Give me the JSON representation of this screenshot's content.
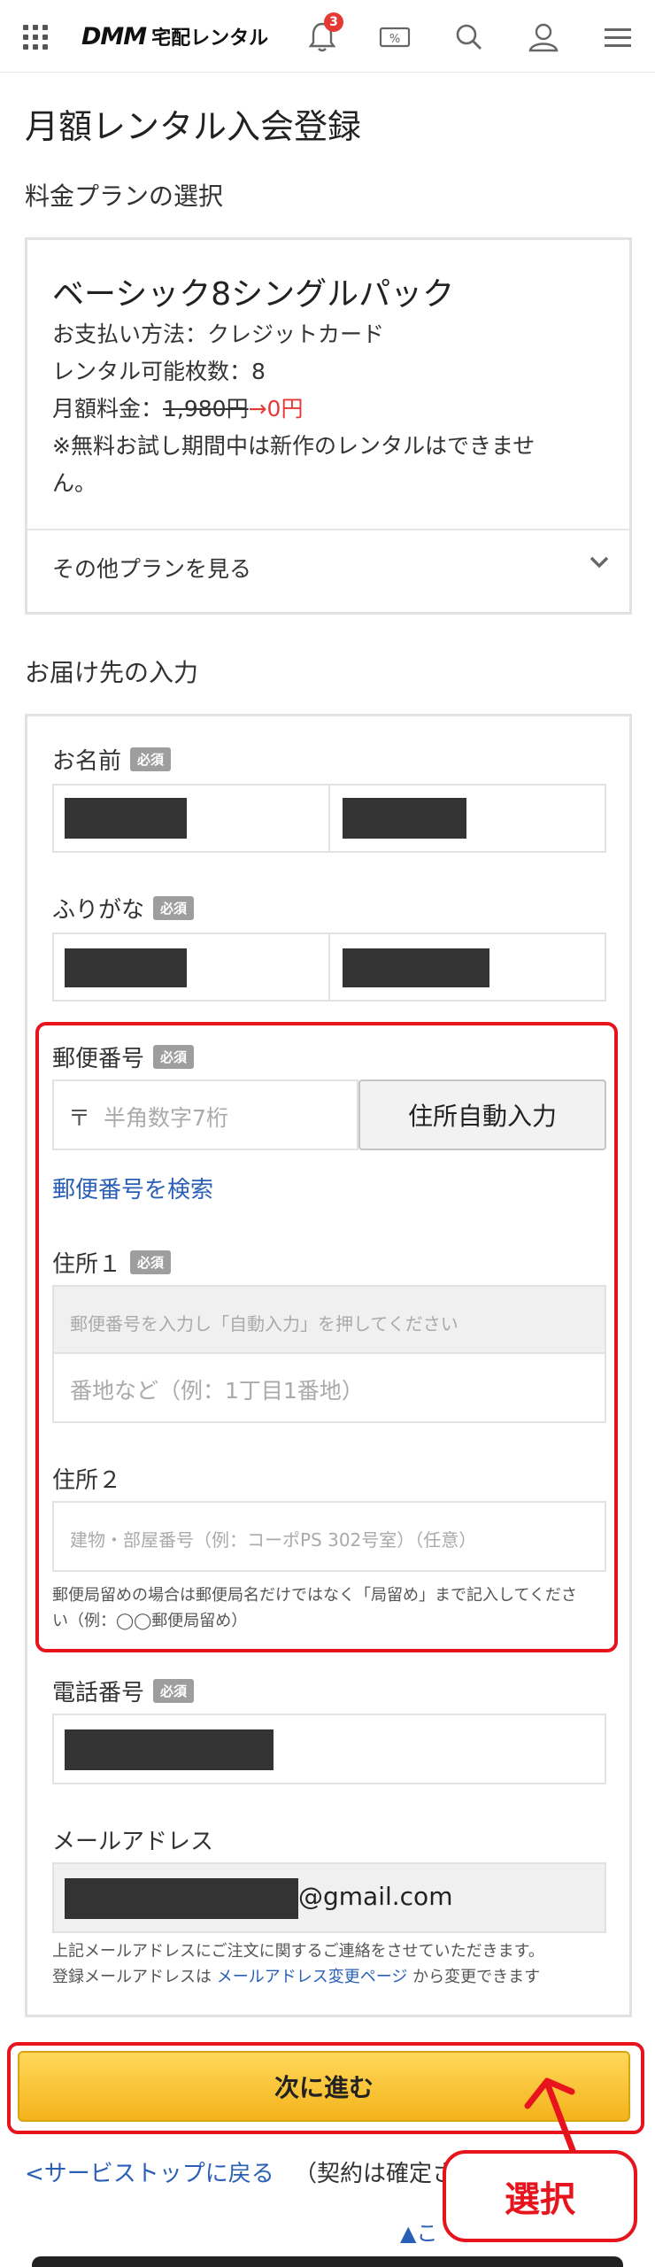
{
  "header": {
    "logo_dmm": "DMM",
    "logo_service": "宅配レンタル",
    "notification_count": "3",
    "coupon_symbol": "%"
  },
  "page": {
    "title": "月額レンタル入会登録"
  },
  "plan_section": {
    "title": "料金プランの選択",
    "plan_name": "ベーシック8シングルパック",
    "payment": "お支払い方法：クレジットカード",
    "rental_count": "レンタル可能枚数：8",
    "fee_label": "月額料金：",
    "fee_old": "1,980円",
    "fee_arrow": "→",
    "fee_new": "0円",
    "notice_line1": "※無料お試し期間中は新作のレンタルはできませ",
    "notice_line2": "ん。",
    "other_plans": "その他プランを見る"
  },
  "delivery_section": {
    "title": "お届け先の入力",
    "required_badge": "必須",
    "name_label": "お名前",
    "furigana_label": "ふりがな",
    "postal_label": "郵便番号",
    "postal_prefix": "〒",
    "postal_placeholder": "半角数字7桁",
    "auto_fill_button": "住所自動入力",
    "postal_search_link": "郵便番号を検索",
    "address1_label": "住所１",
    "address1_auto_placeholder": "郵便番号を入力し「自動入力」を押してください",
    "address1_detail_placeholder": "番地など（例：1丁目1番地）",
    "address2_label": "住所２",
    "address2_placeholder": "建物・部屋番号（例：コーポPS 302号室）（任意）",
    "post_office_note_line1": "郵便局留めの場合は郵便局名だけではなく「局留め」まで記入してくださ",
    "post_office_note_line2": "い（例：◯◯郵便局留め）",
    "phone_label": "電話番号",
    "email_label": "メールアドレス",
    "email_suffix": "@gmail.com",
    "email_note_line1": "上記メールアドレスにご注文に関するご連絡をさせていただきます。",
    "email_note_prefix": "登録メールアドレスは",
    "email_change_link": "メールアドレス変更ページ",
    "email_note_suffix": "から変更できます"
  },
  "actions": {
    "next_button": "次に進む",
    "back_link": "<サービストップに戻る",
    "back_tail": "（契約は確定さ",
    "top_link": "▲こ",
    "callout": "選択"
  },
  "colors": {
    "accent_red": "#e8141d",
    "link_blue": "#2a5fb8",
    "button_yellow": "#f4b31b"
  }
}
